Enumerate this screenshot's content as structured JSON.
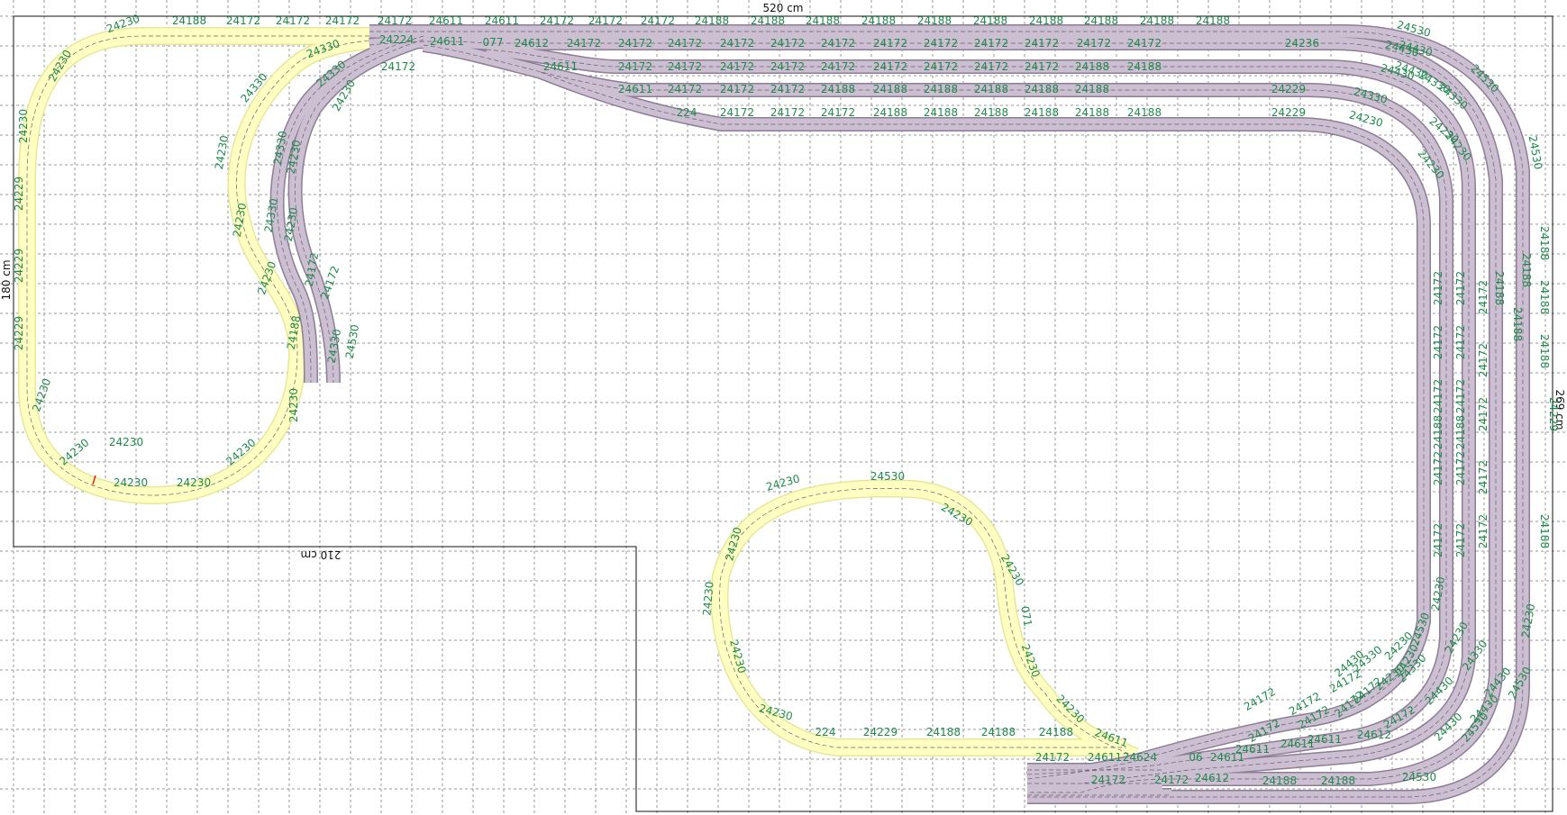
{
  "dimensions": {
    "top": "520 cm",
    "left": "180 cm",
    "right": "269 cm",
    "middle": "210 cm"
  },
  "colors": {
    "loop_track": "#ffffc2",
    "main_track": "#cdbfd2",
    "label": "#1e8a4a",
    "grid": "#9a9a9a"
  },
  "part_labels": {
    "top_row": [
      "24230",
      "24188",
      "24172",
      "24172",
      "24172",
      "24172",
      "24611",
      "24611",
      "24172",
      "24172",
      "24172",
      "24188",
      "24188",
      "24188",
      "24188",
      "24188",
      "24188",
      "24188",
      "24188",
      "24188",
      "24188",
      "24530"
    ],
    "row2": [
      "24224",
      "24611",
      "077",
      "24612",
      "24172",
      "24172",
      "24172",
      "24172",
      "24172",
      "24172",
      "24172",
      "24172",
      "24172",
      "24172",
      "24172",
      "24172",
      "24236",
      "24430"
    ],
    "row3": [
      "24172",
      "24611",
      "24172",
      "24172",
      "24172",
      "24172",
      "24172",
      "24172",
      "24172",
      "24172",
      "24172",
      "24188",
      "24188",
      "24430"
    ],
    "row4": [
      "24611",
      "24172",
      "24172",
      "24172",
      "24188",
      "24188",
      "24188",
      "24188",
      "24188",
      "24188",
      "24229",
      "24330"
    ],
    "row5": [
      "224",
      "24172",
      "24172",
      "24172",
      "24188",
      "24188",
      "24188",
      "24188",
      "24188",
      "24188",
      "24229",
      "24230"
    ],
    "left_loop": [
      "24230",
      "24230",
      "24229",
      "24229",
      "24229",
      "24230",
      "24230",
      "24230",
      "24230"
    ],
    "inner_curve": [
      "24330",
      "24330",
      "24230",
      "24230",
      "24230",
      "24188",
      "24230",
      "24230",
      "24230"
    ],
    "spur": [
      "24330",
      "24230",
      "24330",
      "24230",
      "24330",
      "24230",
      "24172",
      "24172",
      "24330",
      "24530"
    ],
    "right_side": [
      "24430",
      "24430",
      "24330",
      "24330",
      "24530",
      "24230",
      "24230",
      "24230",
      "24530",
      "24188",
      "24188",
      "24188",
      "24188",
      "24188",
      "24188",
      "24229",
      "24188",
      "24172",
      "24172",
      "24172",
      "24172",
      "24172",
      "24172",
      "24172",
      "24172",
      "24172",
      "24172",
      "24188",
      "24188",
      "24172",
      "24172",
      "24172",
      "24172",
      "24172",
      "24230",
      "24230",
      "24330",
      "24430",
      "24430",
      "24530",
      "24230",
      "24530",
      "24230"
    ],
    "bottom_loop": [
      "24230",
      "24530",
      "24230",
      "24230",
      "24230",
      "24230",
      "24230",
      "071",
      "24230",
      "24230",
      "24230",
      "224",
      "24229",
      "24188",
      "24188",
      "24188",
      "24611"
    ],
    "bottom_yard": [
      "24172",
      "24611",
      "24624",
      "06",
      "24611",
      "24612",
      "24188",
      "24188",
      "24530",
      "24172",
      "24172",
      "24611",
      "24611",
      "24172",
      "24172",
      "24172",
      "24172",
      "24230",
      "24330",
      "24430",
      "24430",
      "24530",
      "24172",
      "24611",
      "24612",
      "24172",
      "24172",
      "24172",
      "24230",
      "24330",
      "24430"
    ]
  }
}
